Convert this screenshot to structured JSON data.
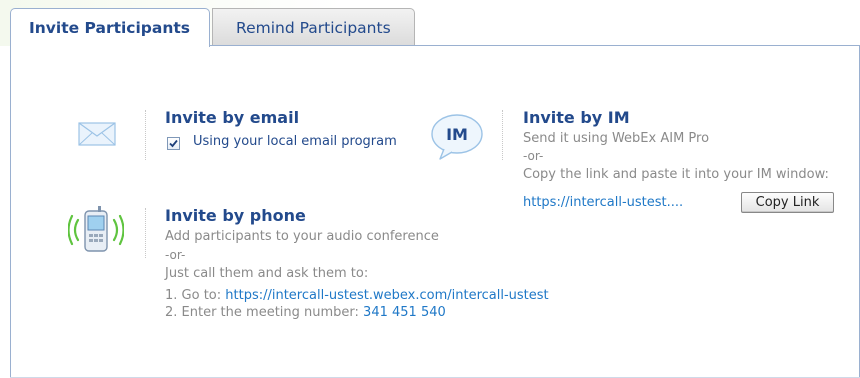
{
  "tabs": {
    "invite_label": "Invite Participants",
    "remind_label": "Remind Participants"
  },
  "email": {
    "heading": "Invite by email",
    "checkbox_label": "Using your local email program",
    "checked": true
  },
  "im": {
    "icon_text": "IM",
    "heading": "Invite by IM",
    "line1": "Send it using WebEx AIM Pro",
    "or": "-or-",
    "line2": "Copy the link and paste it into your IM window:",
    "link": "https://intercall-ustest....",
    "copy_button": "Copy Link"
  },
  "phone": {
    "heading": "Invite by phone",
    "line1": "Add participants to your audio conference",
    "or": "-or-",
    "line2": "Just call them and ask them to:",
    "step1_prefix": "1. Go to: ",
    "step1_link": "https://intercall-ustest.webex.com/intercall-ustest",
    "step2_prefix": "2. Enter the meeting number: ",
    "meeting_number": "341 451 540"
  },
  "colors": {
    "heading": "#234a8c",
    "link": "#1f78c7",
    "muted_text": "#8a8a8a",
    "tab_border": "#9ab0d0"
  },
  "icons": [
    "envelope-icon",
    "im-bubble-icon",
    "mobile-phone-icon",
    "checkmark-icon"
  ]
}
